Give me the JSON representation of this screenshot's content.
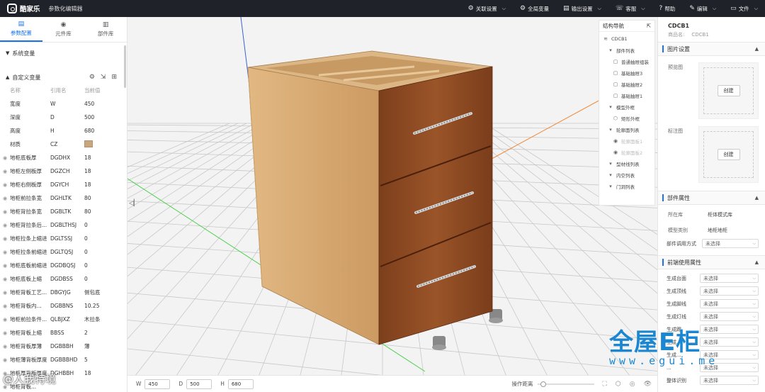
{
  "topbar": {
    "brand": "酷家乐",
    "title": "参数化编辑器",
    "menu": [
      {
        "icon": "⚙",
        "label": "关联设置",
        "caret": true
      },
      {
        "icon": "⚙",
        "label": "全局变量",
        "caret": false
      },
      {
        "icon": "▤",
        "label": "输出设置",
        "caret": true
      },
      {
        "icon": "☏",
        "label": "客服",
        "caret": true
      },
      {
        "icon": "?",
        "label": "帮助",
        "caret": false
      },
      {
        "icon": "✎",
        "label": "编辑",
        "caret": true
      },
      {
        "icon": "▭",
        "label": "文件",
        "caret": true
      }
    ]
  },
  "left": {
    "tabs": [
      "参数配置",
      "元件库",
      "部件库"
    ],
    "system_vars": "系统变量",
    "custom_vars": "自定义变量",
    "columns": [
      "名称",
      "引用名",
      "当前值"
    ],
    "rows": [
      {
        "name": "宽度",
        "ref": "W",
        "val": "450",
        "eye": false
      },
      {
        "name": "深度",
        "ref": "D",
        "val": "500",
        "eye": false
      },
      {
        "name": "高度",
        "ref": "H",
        "val": "680",
        "eye": false
      },
      {
        "name": "材质",
        "ref": "CZ",
        "val": "",
        "eye": false
      },
      {
        "name": "地柜底板厚",
        "ref": "DGDHX",
        "val": "18",
        "eye": true
      },
      {
        "name": "地柜左侧板厚",
        "ref": "DGZCH",
        "val": "18",
        "eye": true
      },
      {
        "name": "地柜右侧板厚",
        "ref": "DGYCH",
        "val": "18",
        "eye": true
      },
      {
        "name": "地柜前拉条宽",
        "ref": "DGHLTK",
        "val": "80",
        "eye": true
      },
      {
        "name": "地柜背拉条宽",
        "ref": "DGBLTK",
        "val": "80",
        "eye": true
      },
      {
        "name": "地柜背拉条后...",
        "ref": "DGBLTHSJ",
        "val": "0",
        "eye": true
      },
      {
        "name": "地柜拉条上缩进",
        "ref": "DGLTSSJ",
        "val": "0",
        "eye": true
      },
      {
        "name": "地柜拉条前缩进",
        "ref": "DGLTQSJ",
        "val": "0",
        "eye": true
      },
      {
        "name": "地柜底板前缩进",
        "ref": "DGDBQSJ",
        "val": "0",
        "eye": true
      },
      {
        "name": "地柜底板上缩",
        "ref": "DGDBSS",
        "val": "0",
        "eye": true
      },
      {
        "name": "地柜背板工艺...",
        "ref": "DBGYJG",
        "val": "侧包底",
        "eye": true
      },
      {
        "name": "地柜背板内...",
        "ref": "DGBBNS",
        "val": "10.25",
        "eye": true
      },
      {
        "name": "地柜前拉条件...",
        "ref": "QLBJXZ",
        "val": "木拉条",
        "eye": true
      },
      {
        "name": "地柜背板上缩",
        "ref": "BBSS",
        "val": "2",
        "eye": true
      },
      {
        "name": "地柜背板厚薄",
        "ref": "DGBBBH",
        "val": "薄",
        "eye": true
      },
      {
        "name": "地柜薄背板厚度",
        "ref": "DGBBBHD",
        "val": "5",
        "eye": true
      },
      {
        "name": "地柜厚背板厚度",
        "ref": "DGHBBH",
        "val": "18",
        "eye": true
      },
      {
        "name": "地柜背板...",
        "ref": "",
        "val": "",
        "eye": true
      }
    ]
  },
  "viewport": {
    "nav_title": "结构导航",
    "nav_items": [
      {
        "label": "CDCB1",
        "indent": 0,
        "icon": "≋",
        "dim": false
      },
      {
        "label": "部件列表",
        "indent": 1,
        "icon": "▾",
        "dim": false
      },
      {
        "label": "普通抽屉组装",
        "indent": 2,
        "icon": "▢",
        "dim": false
      },
      {
        "label": "基础抽屉3",
        "indent": 2,
        "icon": "▢",
        "dim": false
      },
      {
        "label": "基础抽屉2",
        "indent": 2,
        "icon": "▢",
        "dim": false
      },
      {
        "label": "基础抽屉1",
        "indent": 2,
        "icon": "▢",
        "dim": false
      },
      {
        "label": "模型外框",
        "indent": 1,
        "icon": "▾",
        "dim": false
      },
      {
        "label": "矩形外框",
        "indent": 2,
        "icon": "⬡",
        "dim": false
      },
      {
        "label": "轮廓面列表",
        "indent": 1,
        "icon": "▾",
        "dim": false
      },
      {
        "label": "轮廓面板1",
        "indent": 2,
        "icon": "◉",
        "dim": true
      },
      {
        "label": "轮廓面板2",
        "indent": 2,
        "icon": "◉",
        "dim": true
      },
      {
        "label": "型材线列表",
        "indent": 1,
        "icon": "▾",
        "dim": false
      },
      {
        "label": "内空列表",
        "indent": 1,
        "icon": "▾",
        "dim": false
      },
      {
        "label": "门洞列表",
        "indent": 1,
        "icon": "▾",
        "dim": false
      }
    ]
  },
  "right": {
    "title": "CDCB1",
    "product_label": "商品名:",
    "product_value": "CDCB1",
    "image_section": "图片设置",
    "preview_label": "预览图",
    "annot_label": "标注图",
    "create_button": "创建",
    "props_section": "部件属性",
    "props": [
      {
        "k": "所在库",
        "v": "柜体模式库"
      },
      {
        "k": "模型类别",
        "v": "地柜地柜"
      }
    ],
    "call_label": "部件调用方式",
    "unselected": "未选择",
    "front_section": "前端使用属性",
    "front_rows": [
      "生成台面",
      "生成顶线",
      "生成脚线",
      "生成灯线",
      "生成踢",
      "生成...",
      "生成...",
      "...",
      "整体识别"
    ]
  },
  "bottom": {
    "w_label": "W",
    "w_value": "450",
    "d_label": "D",
    "d_value": "500",
    "h_label": "H",
    "h_value": "680",
    "zoom_label": "操作距离",
    "zoom_level": 0.05
  },
  "watermark": {
    "title": "全屋E柜",
    "url": "www.egui.me",
    "corner": "@人我特境"
  },
  "colors": {
    "accent": "#1a73e8",
    "material_swatch": "#c8a77e",
    "wood_front": "#8e4a22",
    "wood_side": "#d5a56c",
    "watermark": "#1b86d1"
  }
}
